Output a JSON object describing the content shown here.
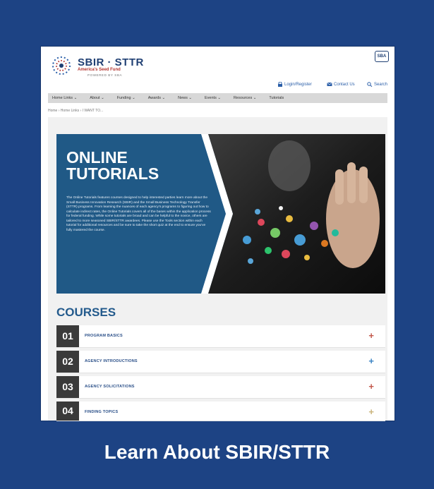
{
  "site": {
    "title": "SBIR · STTR",
    "subtitle": "America's Seed Fund",
    "tagline": "POWERED BY SBA",
    "sba_badge": "SBA"
  },
  "utility": {
    "login": "Login/Register",
    "contact": "Contact Us",
    "search": "Search"
  },
  "nav": [
    "Home Links ⌄",
    "About ⌄",
    "Funding ⌄",
    "Awards ⌄",
    "News ⌄",
    "Events ⌄",
    "Resources ⌄",
    "Tutorials"
  ],
  "breadcrumb": "Home › Home Links › I WANT TO...",
  "hero": {
    "title": "ONLINE TUTORIALS",
    "body": "The Online Tutorials features courses designed to help interested parties learn more about the Small Business Innovation Research (SBIR) and the Small Business Technology Transfer (STTR) programs. From learning the nuances of each agency's programs to figuring out how to calculate indirect rates, the Online Tutorials covers all of the bases within the application process for federal funding. While some tutorials are broad and can be helpful to the novice, others are tailored to more seasoned SBIR/STTR awardees. Please use the Tools section within each tutorial for additional resources and be sure to take the short quiz at the end to ensure you've fully mastered the course."
  },
  "courses_heading": "COURSES",
  "courses": [
    {
      "num": "01",
      "label": "PROGRAM BASICS"
    },
    {
      "num": "02",
      "label": "AGENCY INTRODUCTIONS"
    },
    {
      "num": "03",
      "label": "AGENCY SOLICITATIONS"
    },
    {
      "num": "04",
      "label": "FINDING TOPICS"
    }
  ],
  "caption": "Learn About SBIR/STTR",
  "colors": {
    "background": "#1d4384",
    "hero_panel": "#205986",
    "accent_red": "#c2574a",
    "accent_blue": "#3a83c4"
  }
}
